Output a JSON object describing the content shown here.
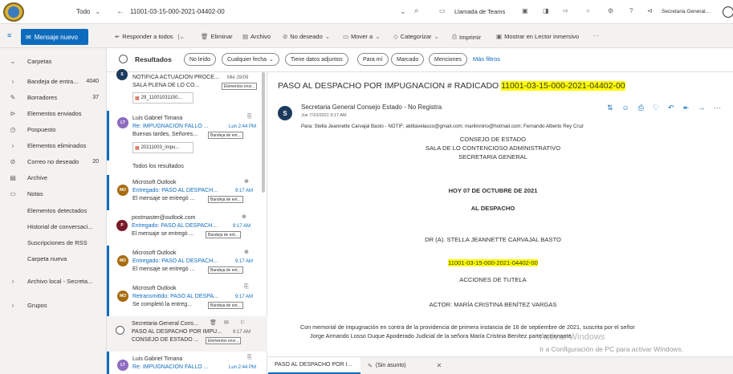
{
  "topbar": {
    "folder_scope": "Todo",
    "search_text": "11001-03-15-000-2021-04402-00",
    "teams_call": "Llamada de Teams",
    "account": "Secretaria General..."
  },
  "ribbon": {
    "new_message": "Mensaje nuevo",
    "reply_all": "Responder a todos",
    "delete": "Eliminar",
    "archive": "Archivo",
    "junk": "No deseado",
    "move_to": "Mover a",
    "categorize": "Categorizar",
    "print": "Imprimir",
    "immersive_reader": "Mostrar en Lector inmersivo",
    "more": "···"
  },
  "filters": {
    "results": "Resultados",
    "unread": "No leído",
    "any_date": "Cualquier fecha",
    "has_attachments": "Tiene datos adjuntos",
    "to_me": "Para mí",
    "flagged": "Marcado",
    "mentions": "Menciones",
    "more_filters": "Más filtros"
  },
  "leftnav": {
    "folders": "Carpetas",
    "items": [
      {
        "label": "Bandeja de entra...",
        "count": "4040"
      },
      {
        "label": "Borradores",
        "count": "37"
      },
      {
        "label": "Elementos enviados",
        "count": ""
      },
      {
        "label": "Pospuesto",
        "count": ""
      },
      {
        "label": "Elementos eliminados",
        "count": ""
      },
      {
        "label": "Correo no deseado",
        "count": "20"
      },
      {
        "label": "Archive",
        "count": ""
      },
      {
        "label": "Notas",
        "count": ""
      },
      {
        "label": "Elementos detectados",
        "count": ""
      },
      {
        "label": "Historial de conversaci...",
        "count": ""
      },
      {
        "label": "Suscripciones de RSS",
        "count": ""
      },
      {
        "label": "Carpeta nueva",
        "count": ""
      }
    ],
    "local_archive": "Archivo local - Secreta...",
    "groups": "Grupos"
  },
  "messages": {
    "item0": {
      "subject": "NOTIFICA ACTUACION PROCE...",
      "time": "Mié 29/09",
      "preview": "SALA PLENA DE LO CO...",
      "tag": "Elementos envi...",
      "attachment": "29_11001031150..."
    },
    "item1": {
      "sender": "Luis Gabriel Timana",
      "subject": "Re: IMPUGNACIÓN FALLO ...",
      "time": "Lun 2:44 PM",
      "preview": "Buenas tardes, Señores...",
      "tag": "Bandeja de ent...",
      "attachment": "20211003_impu...",
      "initials": "LT"
    },
    "all_results": "Todos los resultados",
    "item2": {
      "sender": "Microsoft Outlook",
      "subject": "Entregado: PASO AL DESPACH...",
      "time": "9:17 AM",
      "preview": "El mensaje se entregó ...",
      "tag": "Bandeja de ent...",
      "initials": "MO"
    },
    "item3": {
      "sender": "postmaster@outlook.com",
      "subject": "Entregado: PASO AL DESPACH...",
      "time": "9:17 AM",
      "preview": "El mensaje se entregó ...",
      "tag": "Bandeja de ent...",
      "initials": "P"
    },
    "item4": {
      "sender": "Microsoft Outlook",
      "subject": "Entregado: PASO AL DESPACH...",
      "time": "9:17 AM",
      "preview": "El mensaje se entregó ...",
      "tag": "Bandeja de ent...",
      "initials": "MO"
    },
    "item5": {
      "sender": "Microsoft Outlook",
      "subject": "Retransmitido: PASO AL DESPA...",
      "time": "9:17 AM",
      "preview": "Se completó la entreg...",
      "tag": "Bandeja de ent...",
      "initials": "MO"
    },
    "item6": {
      "sender": "Secretaria General Conse...",
      "subject": "PASO AL DESPACHO POR IMPU...",
      "time": "9:17 AM",
      "preview": "CONSEJO DE ESTADO ...",
      "tag": "Elementos envi..."
    },
    "item7": {
      "sender": "Luis Gabriel Timana",
      "subject": "Re: IMPUGNACIÓN FALLO ...",
      "time": "Lun 2:44 PM",
      "initials": "LT"
    }
  },
  "reading": {
    "subject_prefix": "PASO AL DESPACHO POR IMPUGNACION # RADICADO",
    "subject_radicado": "11001-03-15-000-2021-04402-00",
    "sender": "Secretaria General Consejo Estado - No Registra",
    "sender_initial": "S",
    "date": "Jue 7/10/2021 9:17 AM",
    "to": "Para: Stella Jeannette Carvajal Basto - NOTIF; alditavelasco@gmail.com; marilinnino@hotmail.com; Fernando Alberto Rey Cruz",
    "body": {
      "l1": "CONSEJO DE ESTADO",
      "l2": "SALA DE LO CONTENCIOSO ADMINISTRATIVO",
      "l3": "SECRETARIA GENERAL",
      "l4": "HOY 07 DE OCTUBRE DE 2021",
      "l5": "AL DESPACHO",
      "l6": "DR (A). STELLA JEANNETTE CARVAJAL BASTO",
      "l7": "11001-03-15-000-2021-04402-00",
      "l8": "ACCIONES DE TUTELA",
      "l9": "ACTOR: MARÍA CRISTINA BENÍTEZ VARGAS",
      "p1": "Con memorial de impugnación en contra de la providencia de primera instancia de 16 de septiembre de 2021, suscrita por el señor",
      "p2": "Jorge Armando Losso Duque Apoderado Judicial de la señora María Cristina Benítez parte accionante."
    },
    "watermark1": "Activar Windows",
    "watermark2": "Ir a Configuración de PC para activar Windows."
  },
  "bottomtabs": {
    "tab1": "PASO AL DESPACHO POR I...",
    "tab2": "(Sin asunto)"
  },
  "colors": {
    "accent": "#0f6cbd",
    "highlight": "#ffff00"
  }
}
